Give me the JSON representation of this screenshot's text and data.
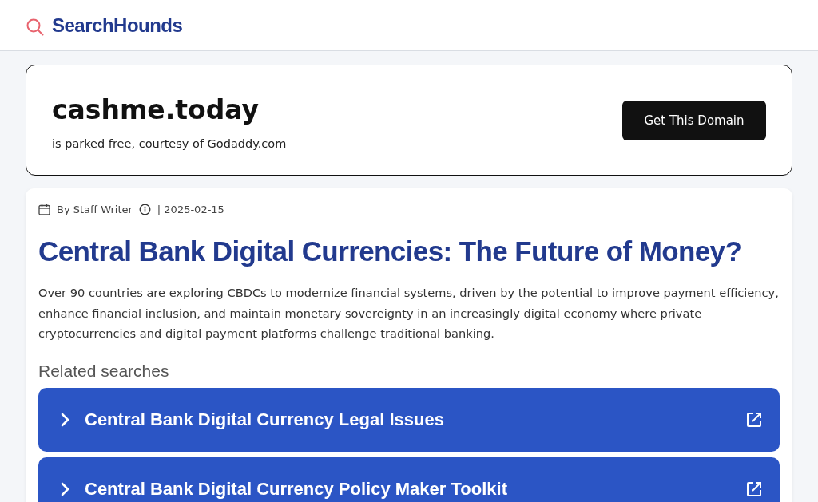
{
  "header": {
    "logo": "SearchHounds"
  },
  "domain_card": {
    "domain": "cashme.today",
    "subtitle": "is parked free, courtesy of Godaddy.com",
    "button": "Get This Domain"
  },
  "article": {
    "author": "By Staff Writer",
    "date": "| 2025-02-15",
    "title": "Central Bank Digital Currencies: The Future of Money?",
    "summary": "Over 90 countries are exploring CBDCs to modernize financial systems, driven by the potential to improve payment efficiency, enhance financial inclusion, and maintain monetary sovereignty in an increasingly digital economy where private cryptocurrencies and digital payment platforms challenge traditional banking."
  },
  "related_searches": {
    "heading": "Related searches",
    "items": [
      "Central Bank Digital Currency Legal Issues",
      "Central Bank Digital Currency Policy Maker Toolkit"
    ]
  }
}
